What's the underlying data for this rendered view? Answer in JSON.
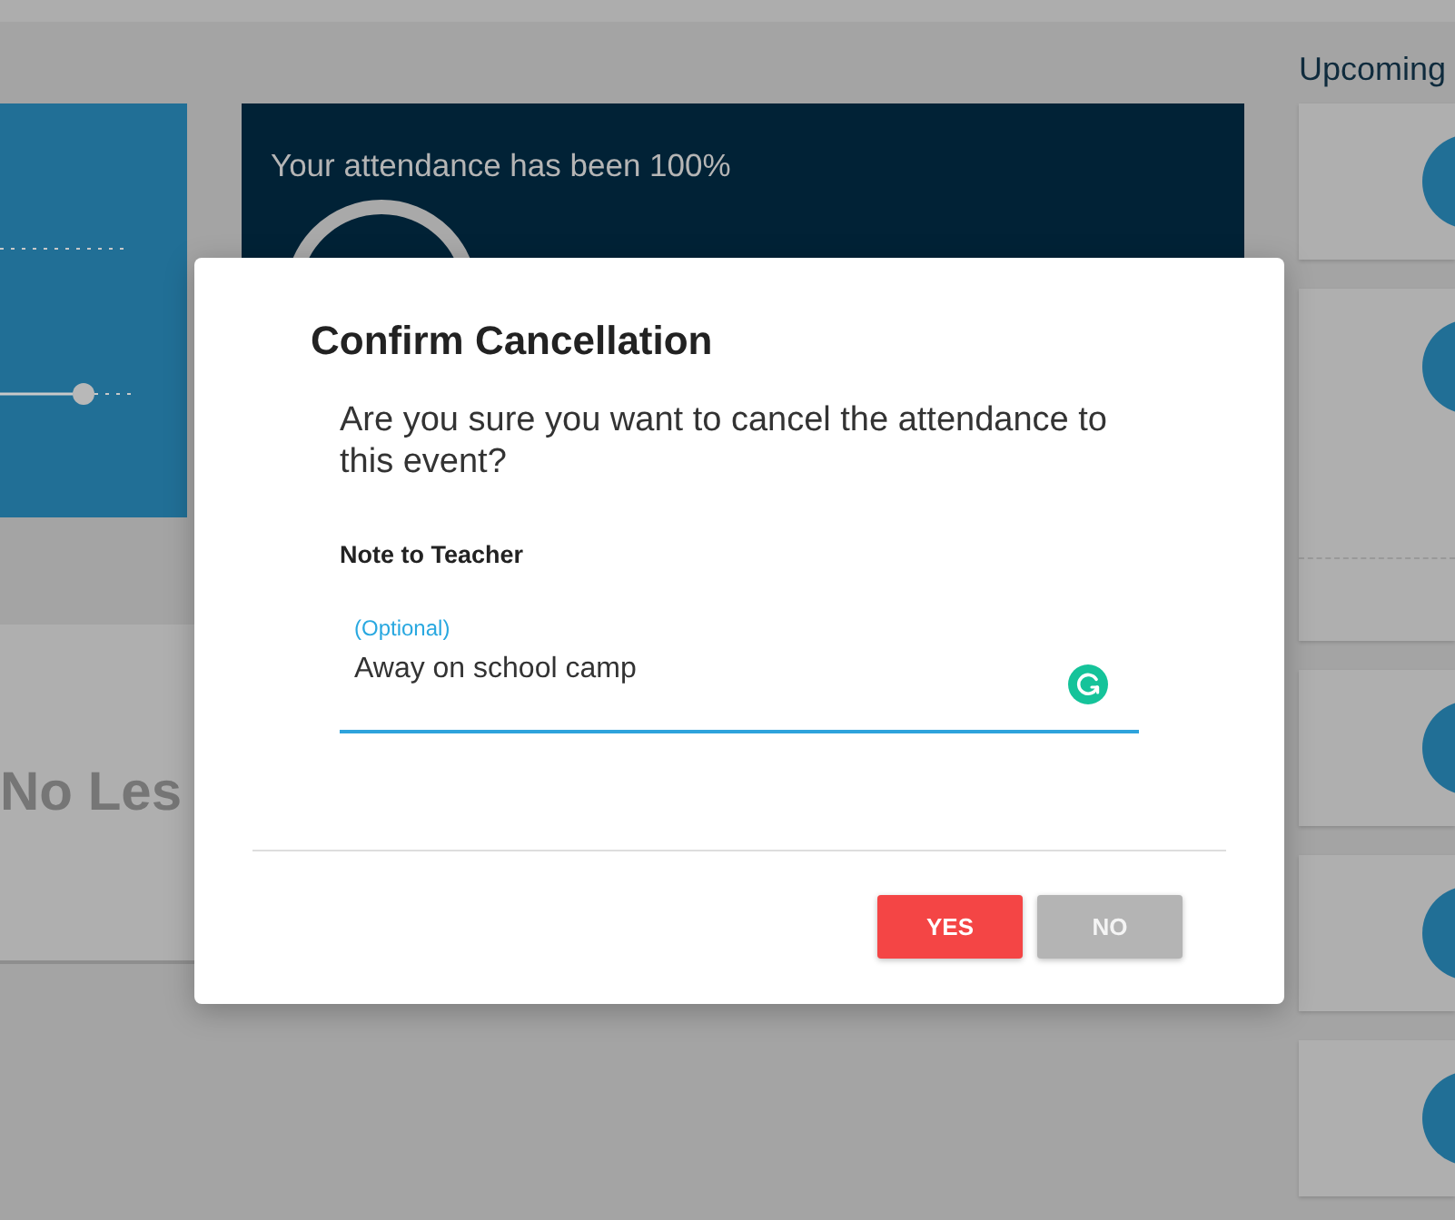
{
  "attendance_card": {
    "text": "Your attendance has been 100%"
  },
  "lessons_card": {
    "text": "No Les"
  },
  "upcoming": {
    "title": "Upcoming",
    "cards": [
      {
        "kind": "single"
      },
      {
        "kind": "split"
      },
      {
        "kind": "single"
      },
      {
        "kind": "single"
      },
      {
        "kind": "single"
      }
    ]
  },
  "dialog": {
    "title": "Confirm Cancellation",
    "message": "Are you sure you want to cancel the attendance to this event?",
    "note_label": "Note to Teacher",
    "note_field": {
      "label": "(Optional)",
      "value": "Away on school camp",
      "focused": true
    },
    "buttons": [
      {
        "label": "YES",
        "kind": "danger"
      },
      {
        "label": "NO",
        "kind": "neutral"
      }
    ]
  }
}
